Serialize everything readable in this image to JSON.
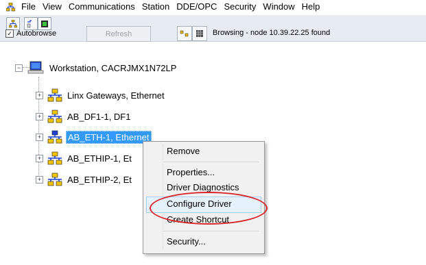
{
  "menubar": {
    "items": [
      "File",
      "View",
      "Communications",
      "Station",
      "DDE/OPC",
      "Security",
      "Window",
      "Help"
    ]
  },
  "toolbar": {
    "autobrowse_label": "Autobrowse",
    "autobrowse_checked": true,
    "refresh_label": "Refresh",
    "status": "Browsing - node 10.39.22.25 found"
  },
  "tree": {
    "root": "Workstation, CACRJMX1N72LP",
    "children": [
      {
        "label": "Linx Gateways, Ethernet"
      },
      {
        "label": "AB_DF1-1, DF1"
      },
      {
        "label": "AB_ETH-1, Ethernet"
      },
      {
        "label": "AB_ETHIP-1, Et"
      },
      {
        "label": "AB_ETHIP-2, Et"
      }
    ]
  },
  "context_menu": {
    "items": [
      "Remove",
      "Properties...",
      "Driver Diagnostics",
      "Configure Driver",
      "Create Shortcut",
      "Security..."
    ]
  },
  "colors": {
    "selection": "#3399ff",
    "highlight_annotation": "#d9232a",
    "toolbar_bg": "#e7ecf3"
  }
}
